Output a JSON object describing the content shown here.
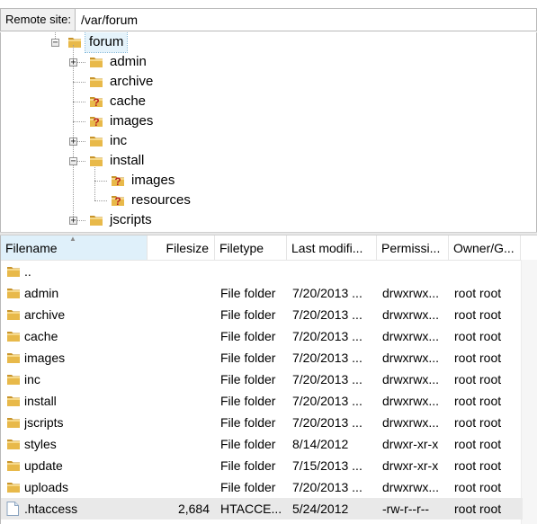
{
  "remote_site": {
    "label": "Remote site:",
    "path": "/var/forum"
  },
  "tree": {
    "root": {
      "label": "forum",
      "expander": "minus"
    },
    "items": [
      {
        "label": "admin",
        "icon": "folder-icon",
        "expander": "plus"
      },
      {
        "label": "archive",
        "icon": "folder-icon",
        "expander": ""
      },
      {
        "label": "cache",
        "icon": "unknown-folder-icon",
        "expander": ""
      },
      {
        "label": "images",
        "icon": "unknown-folder-icon",
        "expander": ""
      },
      {
        "label": "inc",
        "icon": "folder-icon",
        "expander": "plus"
      },
      {
        "label": "install",
        "icon": "folder-icon",
        "expander": "minus"
      },
      {
        "label": "images",
        "icon": "unknown-folder-icon",
        "expander": "",
        "child": true
      },
      {
        "label": "resources",
        "icon": "unknown-folder-icon",
        "expander": "",
        "child": true
      },
      {
        "label": "jscripts",
        "icon": "folder-icon",
        "expander": "plus"
      }
    ]
  },
  "columns": [
    {
      "label": "Filename"
    },
    {
      "label": "Filesize"
    },
    {
      "label": "Filetype"
    },
    {
      "label": "Last modifi..."
    },
    {
      "label": "Permissi..."
    },
    {
      "label": "Owner/G..."
    }
  ],
  "files": [
    {
      "name": "..",
      "size": "",
      "type": "",
      "modified": "",
      "perms": "",
      "owner": "",
      "icon": "folder-icon"
    },
    {
      "name": "admin",
      "size": "",
      "type": "File folder",
      "modified": "7/20/2013 ...",
      "perms": "drwxrwx...",
      "owner": "root root",
      "icon": "folder-icon"
    },
    {
      "name": "archive",
      "size": "",
      "type": "File folder",
      "modified": "7/20/2013 ...",
      "perms": "drwxrwx...",
      "owner": "root root",
      "icon": "folder-icon"
    },
    {
      "name": "cache",
      "size": "",
      "type": "File folder",
      "modified": "7/20/2013 ...",
      "perms": "drwxrwx...",
      "owner": "root root",
      "icon": "folder-icon"
    },
    {
      "name": "images",
      "size": "",
      "type": "File folder",
      "modified": "7/20/2013 ...",
      "perms": "drwxrwx...",
      "owner": "root root",
      "icon": "folder-icon"
    },
    {
      "name": "inc",
      "size": "",
      "type": "File folder",
      "modified": "7/20/2013 ...",
      "perms": "drwxrwx...",
      "owner": "root root",
      "icon": "folder-icon"
    },
    {
      "name": "install",
      "size": "",
      "type": "File folder",
      "modified": "7/20/2013 ...",
      "perms": "drwxrwx...",
      "owner": "root root",
      "icon": "folder-icon"
    },
    {
      "name": "jscripts",
      "size": "",
      "type": "File folder",
      "modified": "7/20/2013 ...",
      "perms": "drwxrwx...",
      "owner": "root root",
      "icon": "folder-icon"
    },
    {
      "name": "styles",
      "size": "",
      "type": "File folder",
      "modified": "8/14/2012",
      "perms": "drwxr-xr-x",
      "owner": "root root",
      "icon": "folder-icon"
    },
    {
      "name": "update",
      "size": "",
      "type": "File folder",
      "modified": "7/15/2013 ...",
      "perms": "drwxr-xr-x",
      "owner": "root root",
      "icon": "folder-icon"
    },
    {
      "name": "uploads",
      "size": "",
      "type": "File folder",
      "modified": "7/20/2013 ...",
      "perms": "drwxrwx...",
      "owner": "root root",
      "icon": "folder-icon"
    },
    {
      "name": ".htaccess",
      "size": "2,684",
      "type": "HTACCE...",
      "modified": "5/24/2012",
      "perms": "-rw-r--r--",
      "owner": "root root",
      "icon": "file-icon",
      "selected": true
    }
  ],
  "colors": {
    "folder": "#e8b94a",
    "folder_dark": "#c8942a",
    "unknown_mark": "#b81e1e",
    "selected_row": "#e9e9e9",
    "sorted_header": "#dff0fa"
  }
}
